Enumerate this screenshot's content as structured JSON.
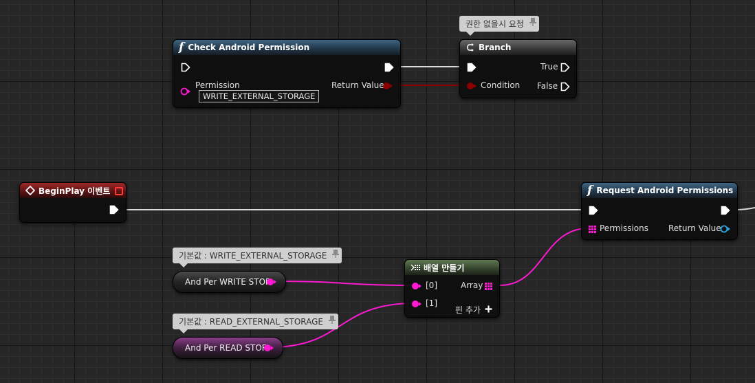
{
  "check_node": {
    "title": "Check Android Permission",
    "param_label": "Permission",
    "param_value": "WRITE_EXTERNAL_STORAGE",
    "return_label": "Return Value"
  },
  "branch_node": {
    "comment": "권한 없을시 요청",
    "title": "Branch",
    "true_label": "True",
    "false_label": "False",
    "condition_label": "Condition"
  },
  "event_node": {
    "title": "BeginPlay 이벤트"
  },
  "request_node": {
    "title": "Request Android Permissions",
    "param_label": "Permissions",
    "return_label": "Return Value"
  },
  "array_node": {
    "title": "배열 만들기",
    "in0_label": "[0]",
    "in1_label": "[1]",
    "out_label": "Array",
    "add_pin_label": "핀 추가"
  },
  "write_var": {
    "tooltip": "기본값 : WRITE_EXTERNAL_STORAGE",
    "label": "And Per WRITE STOR"
  },
  "read_var": {
    "tooltip": "기본값 : READ_EXTERNAL_STORAGE",
    "label": "And Per READ STOR"
  },
  "colors": {
    "exec": "#ffffff",
    "bool": "#8c0000",
    "string_array": "#ff19d2",
    "background": "#262626"
  }
}
